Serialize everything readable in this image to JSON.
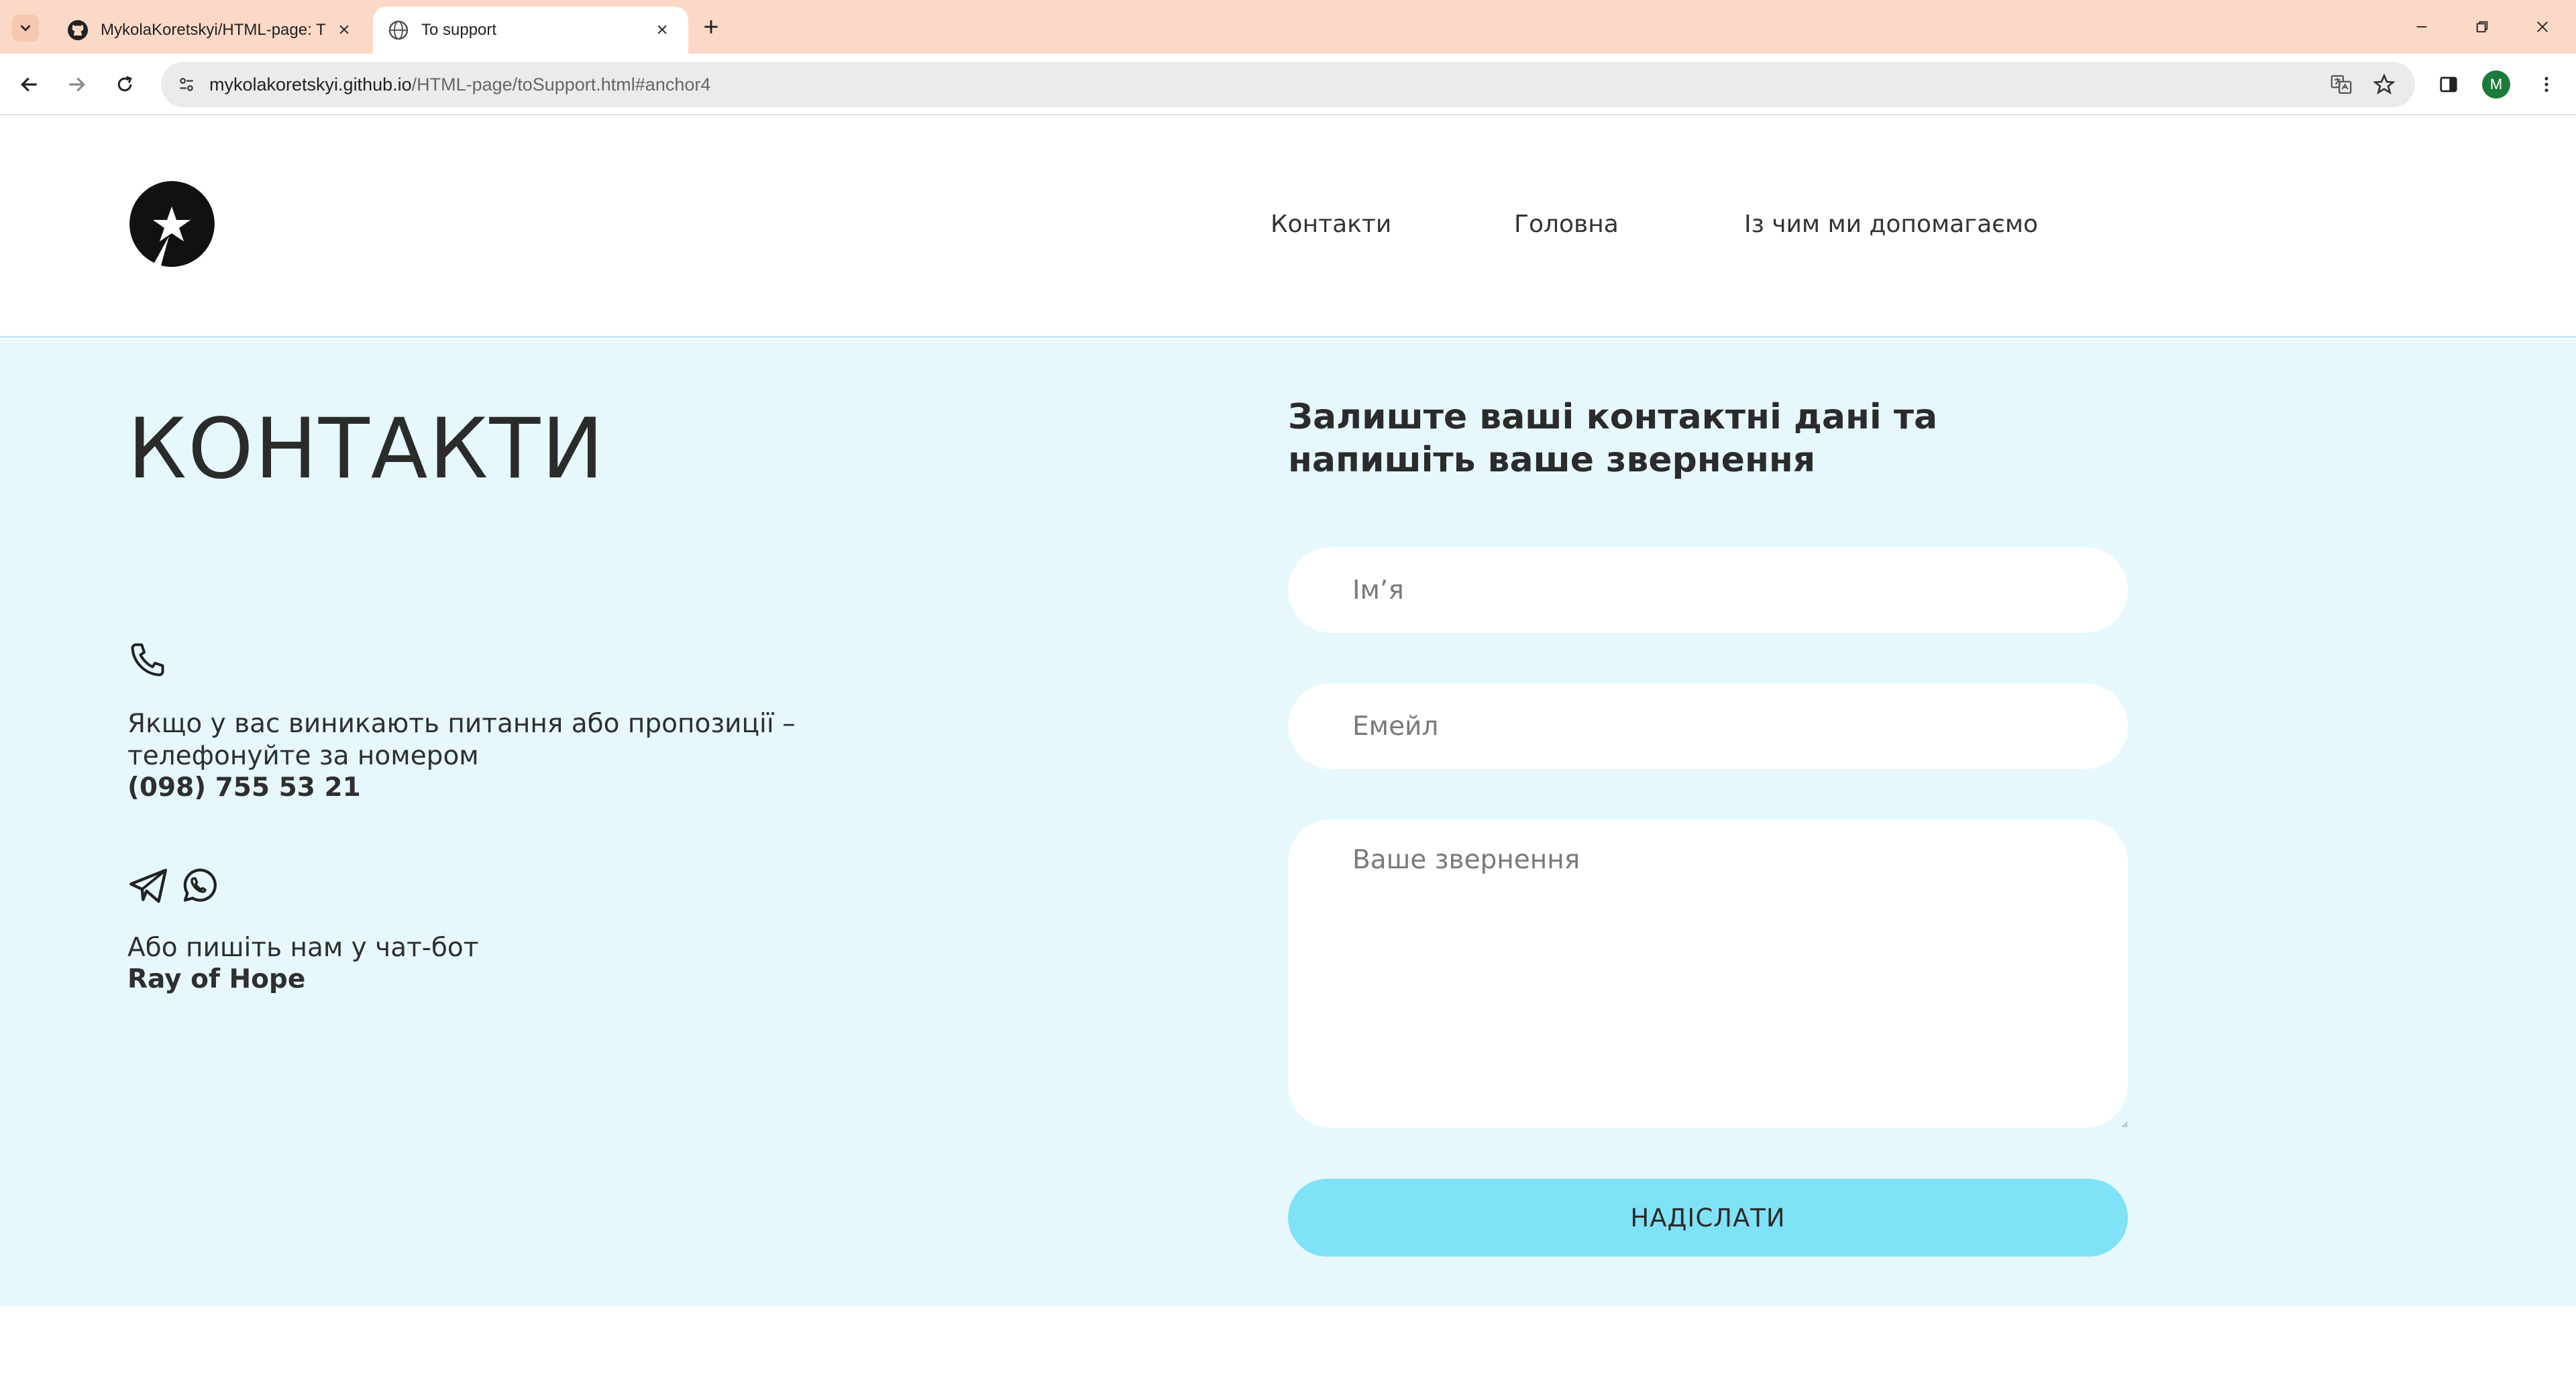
{
  "browser": {
    "tabs": [
      {
        "title": "MykolaKoretskyi/HTML-page: T",
        "icon": "github-icon",
        "active": false
      },
      {
        "title": "To support",
        "icon": "globe-icon",
        "active": true
      }
    ],
    "url_domain": "mykolakoretskyi.github.io",
    "url_path": "/HTML-page/toSupport.html#anchor4",
    "profile_initial": "M",
    "profile_color": "#1e7a3a",
    "tabstrip_color": "#fcd9c6"
  },
  "header": {
    "logo_icon": "star-logo-icon",
    "nav": [
      {
        "label": "Контакти"
      },
      {
        "label": "Головна"
      },
      {
        "label": "Із чим ми допомагаємо"
      }
    ]
  },
  "contacts": {
    "title": "КОНТАКТИ",
    "phone_icon": "phone-icon",
    "phone_text_line1": "Якщо у вас виникають питання або пропозиції –",
    "phone_text_line2": "телефонуйте за номером",
    "phone_number": "(098) 755 53 21",
    "chat_icons": [
      "telegram-icon",
      "whatsapp-icon"
    ],
    "chat_text": "Або пишіть нам у чат-бот",
    "chat_bot_name": "Ray of Hope",
    "background_color": "#e6f8fc"
  },
  "form": {
    "heading_line1": "Залиште ваші контактні дані та",
    "heading_line2": "напишіть ваше звернення",
    "name_placeholder": "Ім’я",
    "email_placeholder": "Емейл",
    "message_placeholder": "Ваше звернення",
    "submit_label": "НАДІСЛАТИ",
    "submit_color": "#7fe2f7"
  }
}
